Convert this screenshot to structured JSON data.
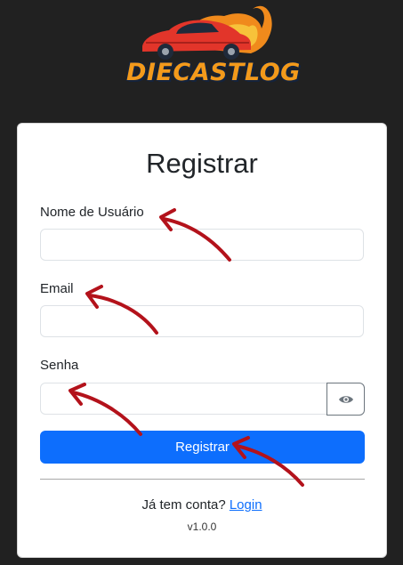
{
  "brand": {
    "name": "DIECASTLOG",
    "logo_icon": "race-car-flame-icon"
  },
  "form": {
    "title": "Registrar",
    "username": {
      "label": "Nome de Usuário",
      "value": "",
      "placeholder": ""
    },
    "email": {
      "label": "Email",
      "value": "",
      "placeholder": ""
    },
    "password": {
      "label": "Senha",
      "value": "",
      "placeholder": "",
      "toggle_icon": "eye-icon"
    },
    "submit_label": "Registrar"
  },
  "footer": {
    "prompt": "Já tem conta?",
    "login_link": "Login",
    "version": "v1.0.0"
  },
  "colors": {
    "background": "#212121",
    "primary": "#0d6efd",
    "annotation_arrow": "#b3121b",
    "brand_orange": "#f39a1b"
  }
}
